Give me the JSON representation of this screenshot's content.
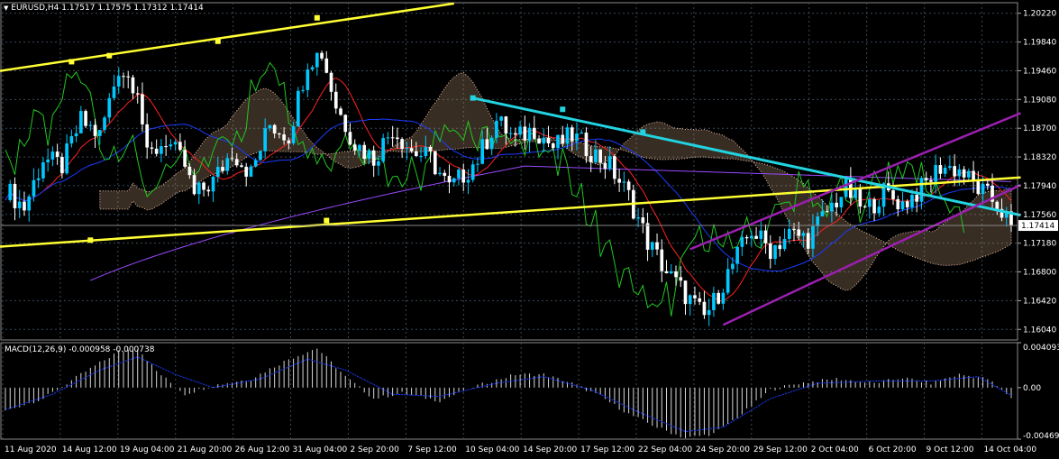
{
  "chart_data": [
    {
      "type": "candlestick",
      "title": "EURUSD,H4  1.17517 1.17575 1.17312 1.17414",
      "symbol": "EURUSD,H4",
      "ohlc_header": [
        "1.17517",
        "1.17575",
        "1.17312",
        "1.17414"
      ],
      "current_price": "1.17414",
      "ylim": [
        1.159,
        1.2036
      ],
      "y_ticks": [
        "1.20220",
        "1.19840",
        "1.19460",
        "1.19080",
        "1.18700",
        "1.18320",
        "1.17940",
        "1.17560",
        "1.17180",
        "1.16800",
        "1.16420",
        "1.16040"
      ],
      "x_ticks": [
        "11 Aug 2020",
        "14 Aug 12:00",
        "19 Aug 04:00",
        "21 Aug 20:00",
        "26 Aug 12:00",
        "31 Aug 04:00",
        "2 Sep 20:00",
        "7 Sep 12:00",
        "10 Sep 04:00",
        "14 Sep 20:00",
        "17 Sep 12:00",
        "22 Sep 04:00",
        "24 Sep 20:00",
        "29 Sep 12:00",
        "2 Oct 04:00",
        "6 Oct 20:00",
        "9 Oct 12:00",
        "14 Oct 04:00"
      ],
      "close_path": [
        [
          0,
          1.179
        ],
        [
          4,
          1.1765
        ],
        [
          8,
          1.183
        ],
        [
          12,
          1.182
        ],
        [
          16,
          1.188
        ],
        [
          20,
          1.186
        ],
        [
          24,
          1.195
        ],
        [
          28,
          1.1925
        ],
        [
          30,
          1.183
        ],
        [
          34,
          1.1855
        ],
        [
          38,
          1.182
        ],
        [
          40,
          1.178
        ],
        [
          44,
          1.18
        ],
        [
          48,
          1.184
        ],
        [
          52,
          1.181
        ],
        [
          56,
          1.1875
        ],
        [
          60,
          1.186
        ],
        [
          64,
          1.196
        ],
        [
          67,
          1.197
        ],
        [
          70,
          1.19
        ],
        [
          74,
          1.185
        ],
        [
          78,
          1.183
        ],
        [
          82,
          1.187
        ],
        [
          86,
          1.184
        ],
        [
          90,
          1.183
        ],
        [
          94,
          1.179
        ],
        [
          98,
          1.1815
        ],
        [
          100,
          1.183
        ],
        [
          104,
          1.188
        ],
        [
          108,
          1.1855
        ],
        [
          112,
          1.187
        ],
        [
          116,
          1.1845
        ],
        [
          120,
          1.186
        ],
        [
          124,
          1.184
        ],
        [
          128,
          1.182
        ],
        [
          132,
          1.178
        ],
        [
          136,
          1.172
        ],
        [
          140,
          1.168
        ],
        [
          144,
          1.165
        ],
        [
          148,
          1.162
        ],
        [
          150,
          1.164
        ],
        [
          154,
          1.169
        ],
        [
          158,
          1.1735
        ],
        [
          162,
          1.171
        ],
        [
          166,
          1.173
        ],
        [
          170,
          1.1725
        ],
        [
          174,
          1.176
        ],
        [
          178,
          1.179
        ],
        [
          182,
          1.176
        ],
        [
          186,
          1.1785
        ],
        [
          190,
          1.177
        ],
        [
          194,
          1.179
        ],
        [
          198,
          1.182
        ],
        [
          202,
          1.1815
        ],
        [
          206,
          1.179
        ],
        [
          210,
          1.177
        ],
        [
          213,
          1.1741
        ]
      ],
      "indicators": [
        "Moving Average (red)",
        "Moving Average (blue)",
        "Moving Average (violet)",
        "Ichimoku Cloud",
        "Chikou line (green)",
        "Trend lines"
      ],
      "colors": {
        "up": "#00c8ff",
        "down": "#ffffff",
        "yellow_lines": "#ffff33",
        "cyan_line": "#22d3e0",
        "channel": "#9b1fb0",
        "red_ma": "#ff2020",
        "blue_ma": "#1a3cff",
        "green_line": "#21c721",
        "violet_ma": "#9a49ff",
        "cloud_a": "#c8a07a",
        "cloud_b": "#f2c7b0",
        "grid": "#394a5a"
      }
    },
    {
      "type": "histogram",
      "title": "MACD(12,26,9) -0.000958 -0.000738",
      "y_ticks": [
        "0.004093",
        "0.00",
        "-0.004691"
      ],
      "ylim": [
        -0.004691,
        0.004093
      ],
      "macd_path": [
        [
          0,
          -0.0021
        ],
        [
          8,
          -0.001
        ],
        [
          16,
          0.0012
        ],
        [
          24,
          0.0033
        ],
        [
          28,
          0.0036
        ],
        [
          32,
          0.0015
        ],
        [
          38,
          -0.0006
        ],
        [
          44,
          0.0002
        ],
        [
          52,
          0.0008
        ],
        [
          60,
          0.0026
        ],
        [
          66,
          0.0036
        ],
        [
          72,
          0.001
        ],
        [
          78,
          -0.001
        ],
        [
          84,
          -0.0005
        ],
        [
          92,
          -0.0012
        ],
        [
          100,
          0.0002
        ],
        [
          108,
          0.0012
        ],
        [
          114,
          0.0012
        ],
        [
          120,
          0.0004
        ],
        [
          126,
          -0.0008
        ],
        [
          132,
          -0.0024
        ],
        [
          138,
          -0.0036
        ],
        [
          144,
          -0.0046
        ],
        [
          150,
          -0.0042
        ],
        [
          156,
          -0.0024
        ],
        [
          162,
          -0.0002
        ],
        [
          168,
          0.0004
        ],
        [
          176,
          0.0008
        ],
        [
          184,
          0.0004
        ],
        [
          190,
          0.0009
        ],
        [
          196,
          0.0004
        ],
        [
          202,
          0.0012
        ],
        [
          208,
          0.0008
        ],
        [
          213,
          -0.0009
        ]
      ],
      "signal_path": [
        [
          0,
          -0.002
        ],
        [
          10,
          -0.0006
        ],
        [
          20,
          0.0016
        ],
        [
          28,
          0.0028
        ],
        [
          36,
          0.0012
        ],
        [
          44,
          0.0
        ],
        [
          54,
          0.0008
        ],
        [
          64,
          0.0026
        ],
        [
          72,
          0.0016
        ],
        [
          82,
          -0.0006
        ],
        [
          92,
          -0.0008
        ],
        [
          104,
          0.0004
        ],
        [
          114,
          0.001
        ],
        [
          124,
          -0.0002
        ],
        [
          134,
          -0.0022
        ],
        [
          144,
          -0.004
        ],
        [
          152,
          -0.0036
        ],
        [
          162,
          -0.001
        ],
        [
          172,
          0.0004
        ],
        [
          184,
          0.0006
        ],
        [
          196,
          0.0006
        ],
        [
          206,
          0.001
        ],
        [
          213,
          -0.0007
        ]
      ],
      "colors": {
        "bars": "#d8d8d8",
        "signal": "#1a3cff"
      }
    }
  ]
}
